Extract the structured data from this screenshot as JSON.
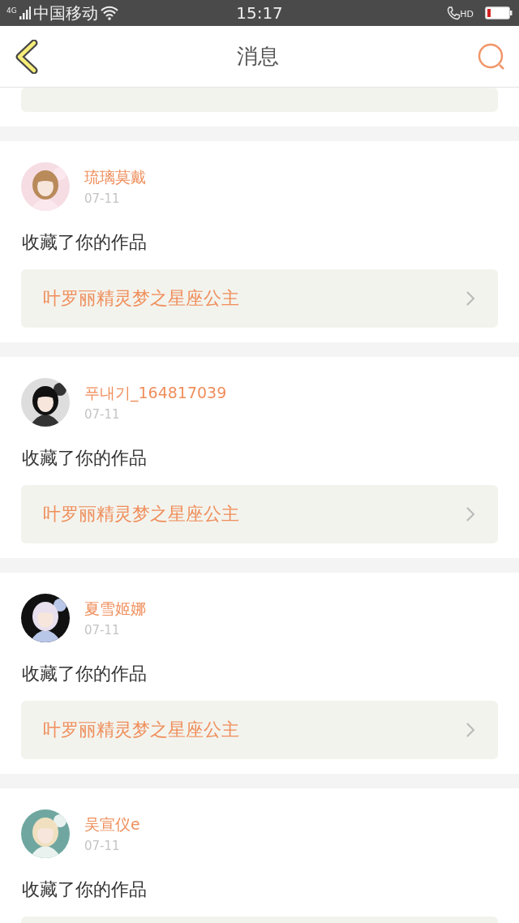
{
  "status_bar": {
    "network": "4G",
    "carrier": "中国移动",
    "time": "15:17",
    "call_badge": "HD"
  },
  "header": {
    "title": "消息"
  },
  "messages": [
    {
      "kind": "clipped"
    },
    {
      "kind": "full",
      "name": "琉璃莫戴",
      "date": "07-11",
      "action": "收藏了你的作品",
      "work": "叶罗丽精灵梦之星座公主"
    },
    {
      "kind": "full",
      "name": "푸내기_164817039",
      "date": "07-11",
      "action": "收藏了你的作品",
      "work": "叶罗丽精灵梦之星座公主"
    },
    {
      "kind": "full",
      "name": "夏雪姬娜",
      "date": "07-11",
      "action": "收藏了你的作品",
      "work": "叶罗丽精灵梦之星座公主"
    },
    {
      "kind": "full",
      "name": "吴宣仪e",
      "date": "07-11",
      "action": "收藏了你的作品"
    }
  ]
}
